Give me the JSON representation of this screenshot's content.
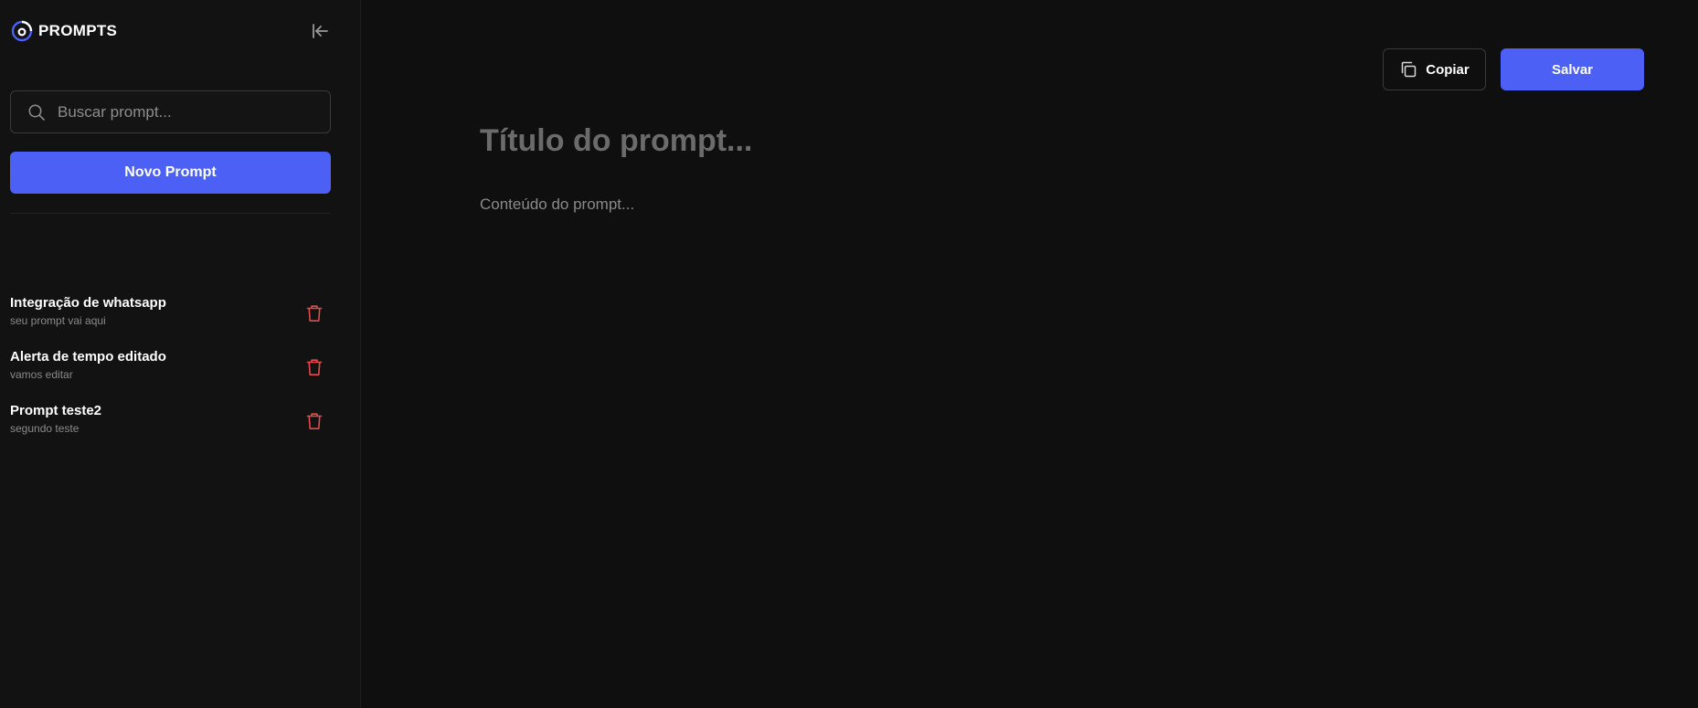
{
  "brand": {
    "name": "PROMPTS"
  },
  "sidebar": {
    "search_placeholder": "Buscar prompt...",
    "new_button_label": "Novo Prompt",
    "items": [
      {
        "title": "Integração de whatsapp",
        "description": "seu prompt vai aqui"
      },
      {
        "title": "Alerta de tempo editado",
        "description": "vamos editar"
      },
      {
        "title": "Prompt teste2",
        "description": "segundo teste"
      }
    ]
  },
  "editor": {
    "copy_label": "Copiar",
    "save_label": "Salvar",
    "title_placeholder": "Título do prompt...",
    "content_placeholder": "Conteúdo do prompt..."
  },
  "icons": {
    "logo": "logo-icon",
    "collapse": "collapse-sidebar-icon",
    "search": "search-icon",
    "delete": "trash-icon",
    "copy": "copy-icon"
  },
  "colors": {
    "accent": "#4c60f5",
    "danger": "#e5484d",
    "background": "#0f0f0f",
    "sidebar": "#121212"
  }
}
